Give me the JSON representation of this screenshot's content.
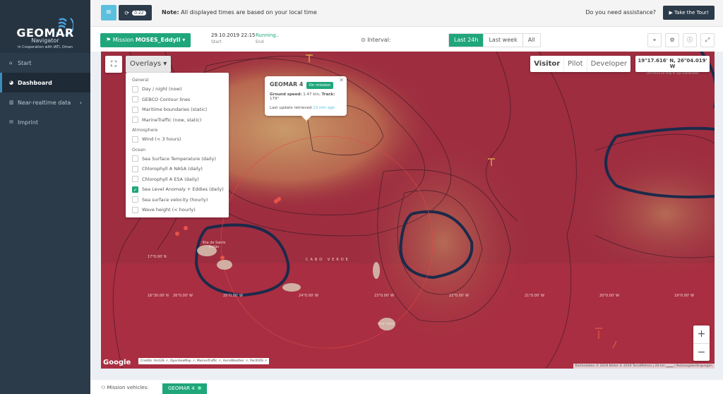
{
  "brand": {
    "title": "GEOMAR",
    "subtitle": "Navigator",
    "cooperation": "In Cooperation with IATI, Oman"
  },
  "sidebar": {
    "items": [
      {
        "label": "Start",
        "icon": "home-icon",
        "active": false
      },
      {
        "label": "Dashboard",
        "icon": "dashboard-icon",
        "active": true
      },
      {
        "label": "Near-realtime data",
        "icon": "chart-icon",
        "active": false,
        "has_submenu": true
      },
      {
        "label": "Imprint",
        "icon": "envelope-icon",
        "active": false
      }
    ]
  },
  "topbar": {
    "refresh_counter": "0:22",
    "note_label": "Note:",
    "note_text": " All displayed times are based on your local time",
    "assist_text": "Do you need assistance?",
    "tour_label": "Take the Tour!"
  },
  "mission": {
    "button_prefix": "Mission ",
    "name": "MOSES_EddyII",
    "start_value": "29.10.2019 22:15",
    "start_label": "Start",
    "end_value": "Running..",
    "end_label": "End",
    "interval_label": "Interval:",
    "intervals": [
      "Last 24h",
      "Last week",
      "All"
    ],
    "selected_interval": "Last 24h"
  },
  "map": {
    "overlays_label": "Overlays",
    "overlay_groups": [
      {
        "heading": "General",
        "items": [
          {
            "label": "Day / night (now)",
            "checked": false
          },
          {
            "label": "GEBCO Contour lines",
            "checked": false
          },
          {
            "label": "Maritime boundaries (static)",
            "checked": false
          },
          {
            "label": "MarineTraffic (now, static)",
            "checked": false
          }
        ]
      },
      {
        "heading": "Atmosphere",
        "items": [
          {
            "label": "Wind (< 3 hours)",
            "checked": false
          }
        ]
      },
      {
        "heading": "Ocean",
        "items": [
          {
            "label": "Sea Surface Temperature (daily)",
            "checked": false
          },
          {
            "label": "Chlorophyll A NASA (daily)",
            "checked": false
          },
          {
            "label": "Chlorophyll A ESA (daily)",
            "checked": false
          },
          {
            "label": "Sea Level Anomaly + Eddies (daily)",
            "checked": true
          },
          {
            "label": "Sea surface velocity (hourly)",
            "checked": false
          },
          {
            "label": "Wave height (< hourly)",
            "checked": false
          }
        ]
      }
    ],
    "popup": {
      "vehicle": "GEOMAR 4",
      "status": "On mission",
      "speed_label": "Ground speed:",
      "speed_value": " 1.47 ktn, ",
      "track_label": "Track:",
      "track_value": " 179°",
      "update_text": "Last update retrieved ",
      "update_ago": "13 min ago"
    },
    "roles": [
      "Visitor",
      "Pilot",
      "Developer"
    ],
    "selected_role": "Visitor",
    "coordinates": "19°17.616' N, 26°04.019' W",
    "coordinates_hint": "Ctrl+click on map to clip coordinates",
    "labels": {
      "island1": "Ilha de Santo Antão",
      "country": "CABO VERDE",
      "island2": "Boa Vista",
      "lat1": "17°0.00' N",
      "lat2": "16°30.00' N",
      "lon26": "26°0.00' W",
      "lon25": "25°0.00' W",
      "lon24": "24°0.00' W",
      "lon23": "23°0.00' W",
      "lon22": "22°0.00' W",
      "lon21": "21°0.00' W",
      "lon20": "20°0.00' W",
      "lon19": "19°0.00' W"
    },
    "google": "Google",
    "credits": "Credits: ArcGIS ↗, OpenSeaMap ↗, MarineTraffic ↗, AerisWeather ↗, PacIOOS ↗",
    "attribution": "Kartendaten © 2019 Bilder © 2019 TerraMetrics | 20 km ▁▁▁ | Nutzungsbedingungen",
    "zoom_in": "+",
    "zoom_out": "−"
  },
  "bottom": {
    "vehicles_label": "Mission vehicles:",
    "vehicle": "GEOMAR 4"
  },
  "colors": {
    "accent": "#1fa67a",
    "sidebar": "#2c3b4a",
    "map_anomaly": "#9a2b3c"
  }
}
